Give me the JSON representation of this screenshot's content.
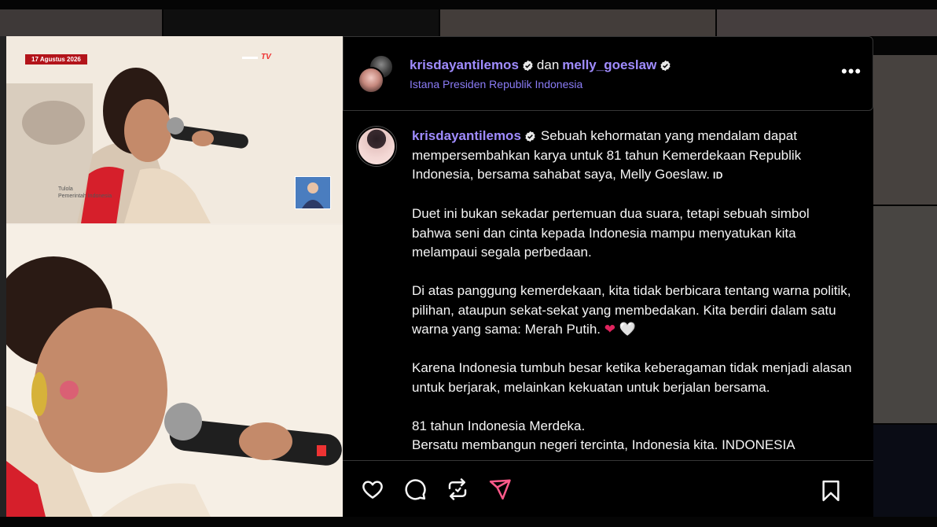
{
  "broadcast": {
    "date_badge": "17 Agustus 2026",
    "channel_logo": "TV",
    "lower_third_name": "Tulola",
    "lower_third_sub": "Pemerintah Indonesia"
  },
  "post": {
    "author": "krisdayantilemos",
    "conjunction": "dan",
    "collaborator": "melly_goeslaw",
    "location": "Istana Presiden Republik Indonesia",
    "more_label": "•••"
  },
  "caption": {
    "author": "krisdayantilemos",
    "p1": "Sebuah kehormatan yang mendalam dapat mempersembahkan karya untuk 81 tahun Kemerdekaan Republik Indonesia, bersama sahabat saya, Melly Goeslaw.",
    "p1_tag": "ID",
    "p2": "Duet ini bukan sekadar pertemuan dua suara, tetapi sebuah simbol bahwa seni dan cinta kepada Indonesia mampu menyatukan kita melampaui segala perbedaan.",
    "p3": "Di atas panggung kemerdekaan, kita tidak berbicara tentang warna politik, pilihan, ataupun sekat-sekat yang membedakan. Kita berdiri dalam satu warna yang sama: Merah Putih.",
    "p3_heart_red": "❤",
    "p3_heart_white": "🤍",
    "p4": "Karena Indonesia tumbuh besar ketika keberagaman tidak menjadi alasan untuk berjarak, melainkan kekuatan untuk berjalan bersama.",
    "p5": "81 tahun Indonesia Merdeka.",
    "p6": "Bersatu membangun negeri tercinta, Indonesia kita. INDONESIA"
  },
  "actions": {
    "like": "heart-icon",
    "comment": "comment-icon",
    "repost": "repost-icon",
    "share": "share-icon",
    "save": "bookmark-icon"
  },
  "colors": {
    "link": "#a08cff",
    "location": "#8b7cf7",
    "badge": "#b3141a"
  }
}
